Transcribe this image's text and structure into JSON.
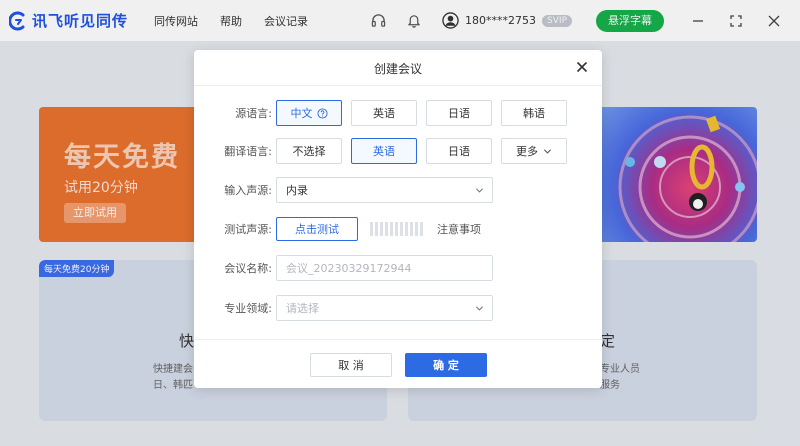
{
  "app": {
    "title": "讯飞听见同传",
    "nav": [
      "同传网站",
      "帮助",
      "会议记录"
    ],
    "user_phone": "180****2753",
    "vip_label": "SVIP",
    "float_caption_label": "悬浮字幕",
    "colors": {
      "brand": "#2155e9",
      "accent_green": "#17b24c",
      "primary": "#2d6be5"
    }
  },
  "background": {
    "promo": {
      "title": "每天免费",
      "subtitle": "试用20分钟",
      "button": "立即试用"
    },
    "card_left": {
      "badge": "每天免费20分钟",
      "title": "快",
      "desc_line1": "快捷建会",
      "desc_line2": "日、韩匹"
    },
    "card_right": {
      "title": "定",
      "desc_line1": "专业人员",
      "desc_line2": "服务"
    }
  },
  "modal": {
    "title": "创建会议",
    "source_language": {
      "label": "源语言:",
      "options": [
        {
          "label": "中文",
          "selected": true,
          "has_help": true
        },
        {
          "label": "英语",
          "selected": false
        },
        {
          "label": "日语",
          "selected": false
        },
        {
          "label": "韩语",
          "selected": false
        }
      ]
    },
    "target_language": {
      "label": "翻译语言:",
      "options": [
        {
          "label": "不选择",
          "selected": false
        },
        {
          "label": "英语",
          "selected": true
        },
        {
          "label": "日语",
          "selected": false
        },
        {
          "label": "更多",
          "selected": false,
          "has_caret": true
        }
      ]
    },
    "input_source": {
      "label": "输入声源:",
      "value": "内录"
    },
    "test_source": {
      "label": "测试声源:",
      "button": "点击测试",
      "notice": "注意事项"
    },
    "meeting_name": {
      "label": "会议名称:",
      "placeholder": "会议_20230329172944"
    },
    "domain": {
      "label": "专业领域:",
      "placeholder": "请选择"
    },
    "cancel_label": "取 消",
    "ok_label": "确 定"
  }
}
